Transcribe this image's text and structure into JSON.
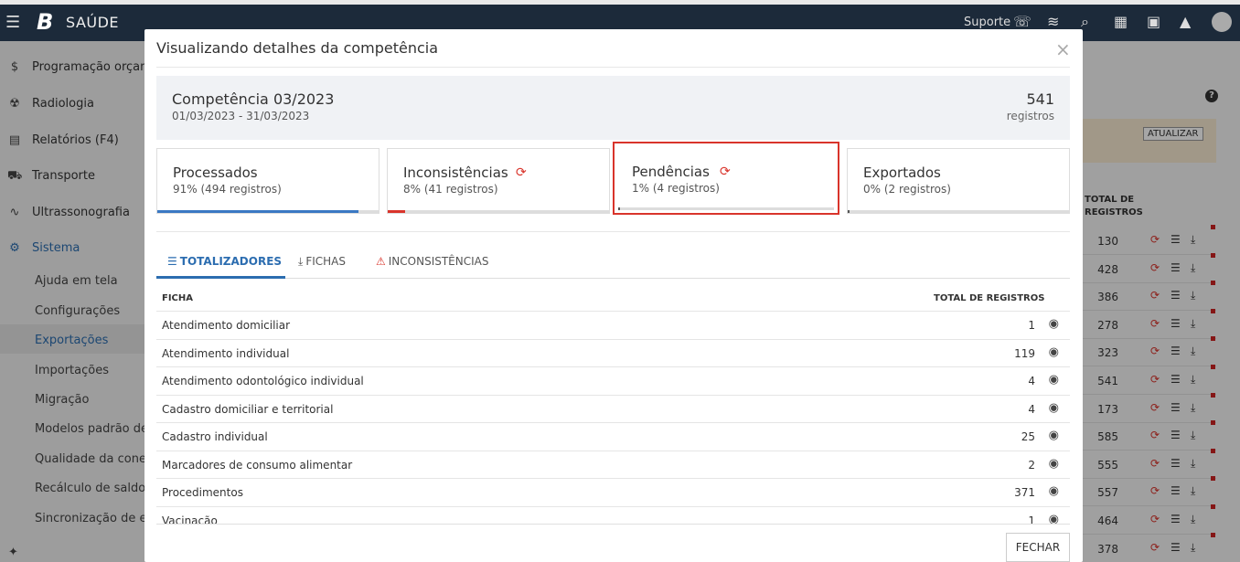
{
  "app": {
    "brand": "SAÚDE",
    "logo_letter": "B",
    "suporte": "Suporte"
  },
  "sidebar": {
    "items": [
      {
        "label": "Programação orçame",
        "icon": "$"
      },
      {
        "label": "Radiologia",
        "icon": "☢"
      },
      {
        "label": "Relatórios (F4)",
        "icon": "▤"
      },
      {
        "label": "Transporte",
        "icon": "🚗"
      },
      {
        "label": "Ultrassonografia",
        "icon": "∿"
      },
      {
        "label": "Sistema",
        "icon": "⚙"
      }
    ],
    "subitems": [
      "Ajuda em tela",
      "Configurações",
      "Exportações",
      "Importações",
      "Migração",
      "Modelos padrão de i",
      "Qualidade da conexã",
      "Recálculo de saldo",
      "Sincronização de ent"
    ]
  },
  "background": {
    "atualizar": "ATUALIZAR",
    "header_total": "TOTAL DE",
    "header_registros": "REGISTROS",
    "values": [
      "130",
      "428",
      "386",
      "278",
      "323",
      "541",
      "173",
      "585",
      "555",
      "557",
      "464",
      "378"
    ]
  },
  "modal": {
    "title": "Visualizando detalhes da competência",
    "close": "×",
    "competencia": "Competência 03/2023",
    "period": "01/03/2023 - 31/03/2023",
    "count": "541",
    "count_label": "registros",
    "cards": [
      {
        "title": "Processados",
        "sub": "91% (494 registros)",
        "percent": 91,
        "color": "#3a78c3"
      },
      {
        "title": "Inconsistências",
        "sub": "8% (41 registros)",
        "percent": 8,
        "color": "#d9342b"
      },
      {
        "title": "Pendências",
        "sub": "1% (4 registros)",
        "percent": 1,
        "color": "#555555"
      },
      {
        "title": "Exportados",
        "sub": "0% (2 registros)",
        "percent": 0,
        "color": "#555555"
      }
    ],
    "tabs": {
      "totalizadores": "TOTALIZADORES",
      "fichas": "FICHAS",
      "inconsistencias": "INCONSISTÊNCIAS"
    },
    "table": {
      "col_ficha": "FICHA",
      "col_total": "TOTAL DE REGISTROS",
      "rows": [
        {
          "name": "Atendimento domiciliar",
          "total": "1"
        },
        {
          "name": "Atendimento individual",
          "total": "119"
        },
        {
          "name": "Atendimento odontológico individual",
          "total": "4"
        },
        {
          "name": "Cadastro domiciliar e territorial",
          "total": "4"
        },
        {
          "name": "Cadastro individual",
          "total": "25"
        },
        {
          "name": "Marcadores de consumo alimentar",
          "total": "2"
        },
        {
          "name": "Procedimentos",
          "total": "371"
        },
        {
          "name": "Vacinação",
          "total": "1"
        }
      ]
    },
    "fechar": "FECHAR"
  }
}
